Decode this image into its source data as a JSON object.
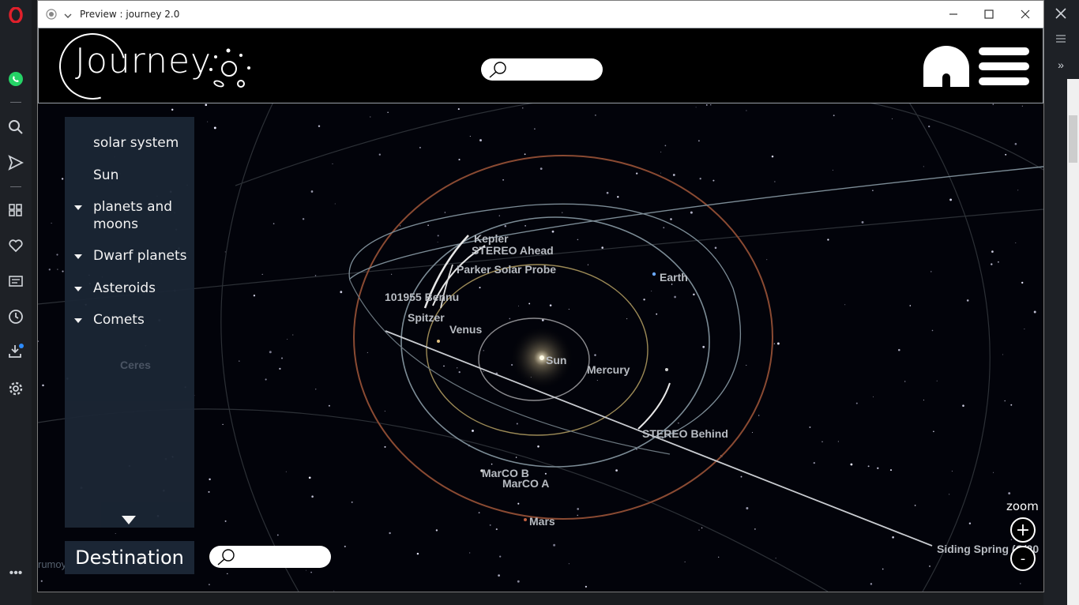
{
  "window": {
    "title": "Preview : journey 2.0"
  },
  "header": {
    "logo": "Journey",
    "search_placeholder": ""
  },
  "nav": {
    "items": [
      {
        "label": "solar system",
        "expandable": false
      },
      {
        "label": "Sun",
        "expandable": false
      },
      {
        "label": "planets and moons",
        "expandable": true
      },
      {
        "label": "Dwarf planets",
        "expandable": true
      },
      {
        "label": "Asteroids",
        "expandable": true
      },
      {
        "label": "Comets",
        "expandable": true
      }
    ],
    "faded_item": "Ceres"
  },
  "destination": {
    "label": "Destination",
    "search_placeholder": ""
  },
  "breadcrumb_faint": "rumoy",
  "zoom": {
    "label": "zoom",
    "in": "+",
    "out": "-"
  },
  "bodies": {
    "kepler": "Kepler",
    "stereo_ahead": "STEREO Ahead",
    "parker": "Parker Solar Probe",
    "earth": "Earth",
    "bennu": "101955 Bennu",
    "spitzer": "Spitzer",
    "venus": "Venus",
    "sun": "Sun",
    "mercury": "Mercury",
    "stereo_behind": "STEREO Behind",
    "marco_b": "MarCO B",
    "marco_a": "MarCO A",
    "mars": "Mars",
    "siding_spring": "Siding Spring (C/20"
  },
  "colors": {
    "space": "#02030a",
    "nav_panel": "#1b2635",
    "mars_orbit": "#8a4a32",
    "earth_orbit": "#7c8c96",
    "venus_orbit": "#9c8a56",
    "mercury_orbit": "#8c8c90"
  }
}
